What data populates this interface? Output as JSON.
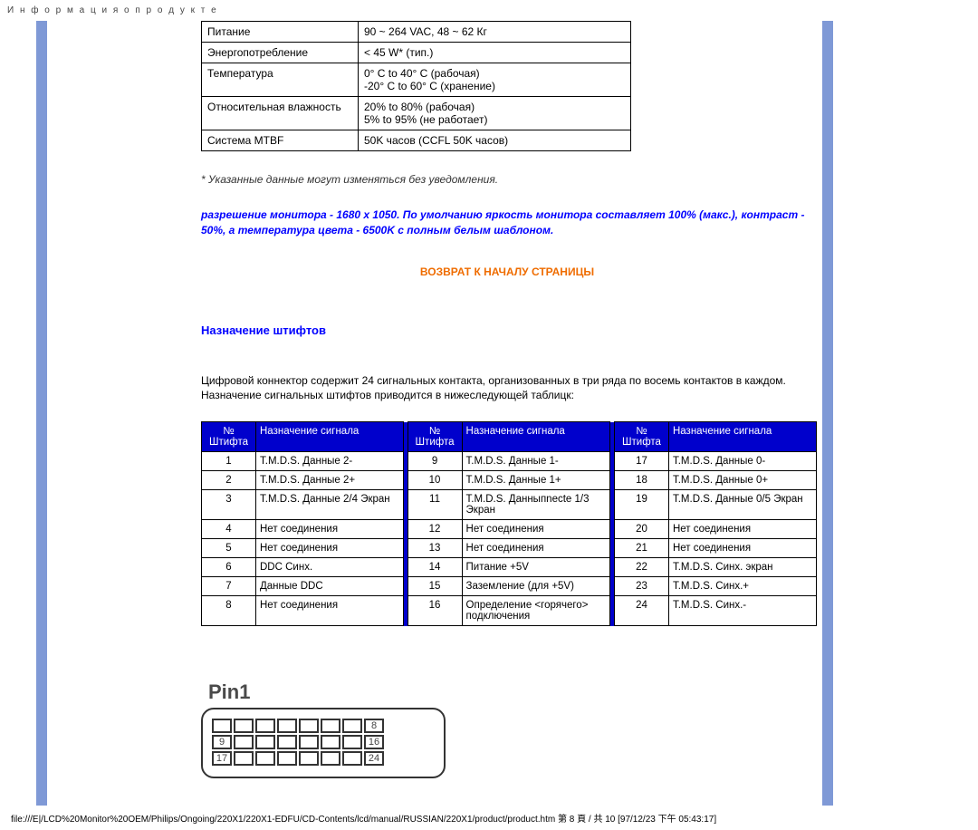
{
  "header": "И н ф о р м а ц и я о п р о д у к т е",
  "specs": [
    {
      "label": "Питание",
      "value": "90 ~ 264 VAC, 48 ~ 62 Кг"
    },
    {
      "label": "Энергопотребление",
      "value": "< 45 W* (тип.)"
    },
    {
      "label": "Температура",
      "value": "0° C to 40° C (рабочая)\n-20° C to 60° C (хранение)"
    },
    {
      "label": "Относительная влажность",
      "value": "20% to 80% (рабочая)\n5% to 95% (не работает)"
    },
    {
      "label": "Система MTBF",
      "value": "50K часов (CCFL 50K часов)"
    }
  ],
  "note_italic": "* Указанные данные могут изменяться без уведомления.",
  "note_blue": "разрешение монитора - 1680 x 1050. По умолчанию яркость монитора составляет 100% (макс.), контраст - 50%, а температура цвета - 6500K с полным белым шаблоном.",
  "return_top": "ВОЗВРАТ К НАЧАЛУ СТРАНИЦЫ",
  "section_title": "Назначение штифтов",
  "pin_desc": "Цифровой коннектор содержит 24 сигнальных контакта, организованных в три ряда по восемь контактов в каждом. Назначение сигнальных штифтов приводится в нижеследующей таблицк:",
  "pin_headers": {
    "pin": "№ Штифта",
    "sig": "Назначение сигнала"
  },
  "pins_col1": [
    {
      "n": "1",
      "s": "T.M.D.S. Данные 2-"
    },
    {
      "n": "2",
      "s": "T.M.D.S. Данные 2+"
    },
    {
      "n": "3",
      "s": "T.M.D.S. Данные 2/4 Экран"
    },
    {
      "n": "4",
      "s": "Нет соединения"
    },
    {
      "n": "5",
      "s": "Нет соединения"
    },
    {
      "n": "6",
      "s": "DDC Синх."
    },
    {
      "n": "7",
      "s": "Данные DDC"
    },
    {
      "n": "8",
      "s": "Нет соединения"
    }
  ],
  "pins_col2": [
    {
      "n": "9",
      "s": "T.M.D.S. Данные 1-"
    },
    {
      "n": "10",
      "s": "T.M.D.S. Данные 1+"
    },
    {
      "n": "11",
      "s": "T.M.D.S. Данныпnecte 1/3 Экран"
    },
    {
      "n": "12",
      "s": "Нет соединения"
    },
    {
      "n": "13",
      "s": "Нет соединения"
    },
    {
      "n": "14",
      "s": "Питание +5V"
    },
    {
      "n": "15",
      "s": "Заземление (для +5V)"
    },
    {
      "n": "16",
      "s": "Определение <горячего> подключения"
    }
  ],
  "pins_col3": [
    {
      "n": "17",
      "s": "T.M.D.S. Данные 0-"
    },
    {
      "n": "18",
      "s": "T.M.D.S. Данные 0+"
    },
    {
      "n": "19",
      "s": "T.M.D.S. Данные 0/5 Экран"
    },
    {
      "n": "20",
      "s": "Нет соединения"
    },
    {
      "n": "21",
      "s": "Нет соединения"
    },
    {
      "n": "22",
      "s": "T.M.D.S. Синх. экран"
    },
    {
      "n": "23",
      "s": "T.M.D.S. Синх.+"
    },
    {
      "n": "24",
      "s": "T.M.D.S. Синх.-"
    }
  ],
  "connector": {
    "label": "Pin1",
    "row1_end": "8",
    "row2_start": "9",
    "row2_end": "16",
    "row3_start": "17",
    "row3_end": "24"
  },
  "footer": "file:///E|/LCD%20Monitor%20OEM/Philips/Ongoing/220X1/220X1-EDFU/CD-Contents/lcd/manual/RUSSIAN/220X1/product/product.htm 第 8 頁 / 共 10 [97/12/23 下午 05:43:17]"
}
